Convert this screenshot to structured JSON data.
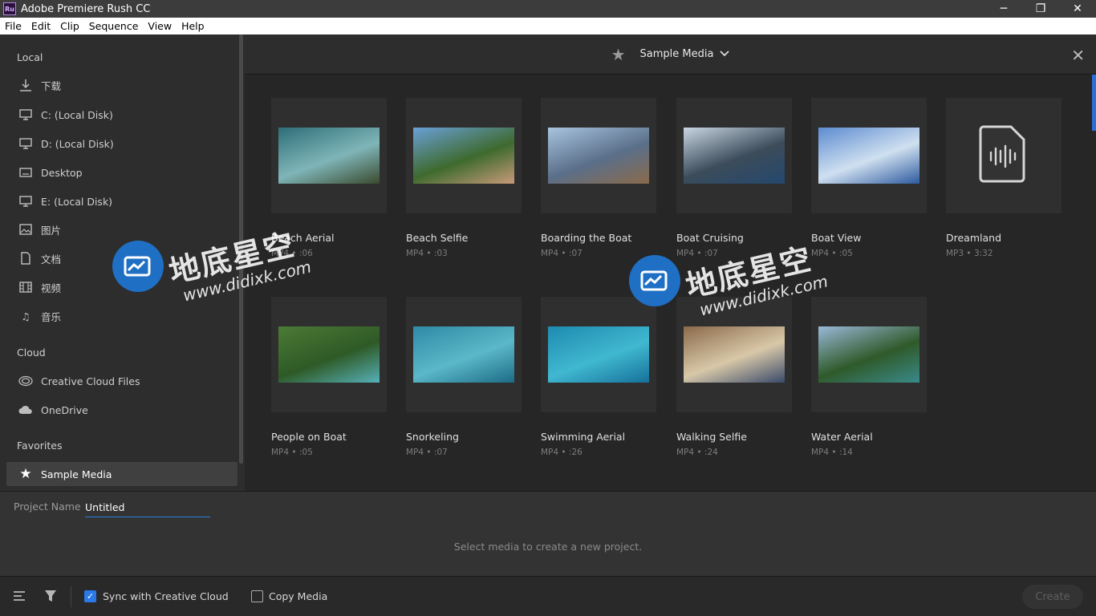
{
  "window": {
    "title": "Adobe Premiere Rush CC",
    "icon_text": "Ru",
    "controls": [
      "─",
      "❐",
      "✕"
    ]
  },
  "menu": [
    "File",
    "Edit",
    "Clip",
    "Sequence",
    "View",
    "Help"
  ],
  "sidebar": {
    "local_heading": "Local",
    "local_items": [
      {
        "label": "下载",
        "icon": "download-icon"
      },
      {
        "label": "C: (Local Disk)",
        "icon": "monitor-icon"
      },
      {
        "label": "D: (Local Disk)",
        "icon": "monitor-icon"
      },
      {
        "label": "Desktop",
        "icon": "desktop-icon"
      },
      {
        "label": "E: (Local Disk)",
        "icon": "monitor-icon"
      },
      {
        "label": "图片",
        "icon": "image-icon"
      },
      {
        "label": "文档",
        "icon": "document-icon"
      },
      {
        "label": "视频",
        "icon": "film-icon"
      },
      {
        "label": "音乐",
        "icon": "music-note-icon"
      }
    ],
    "cloud_heading": "Cloud",
    "cloud_items": [
      {
        "label": "Creative Cloud Files",
        "icon": "creative-cloud-icon"
      },
      {
        "label": "OneDrive",
        "icon": "cloud-icon"
      }
    ],
    "favorites_heading": "Favorites",
    "favorites_items": [
      {
        "label": "Sample Media",
        "icon": "star-icon",
        "active": true
      }
    ]
  },
  "header": {
    "title": "Sample Media",
    "close": "✕"
  },
  "media": [
    {
      "name": "Beach Aerial",
      "meta": "MP4 • :06",
      "colors": [
        "#2e6e78",
        "#7fb5b8",
        "#3a4a2e"
      ]
    },
    {
      "name": "Beach Selfie",
      "meta": "MP4 • :03",
      "colors": [
        "#6aa0d8",
        "#3e6a2e",
        "#c99a7a"
      ]
    },
    {
      "name": "Boarding the Boat",
      "meta": "MP4 • :07",
      "colors": [
        "#a9c4de",
        "#5a6f8a",
        "#8a6a4a"
      ]
    },
    {
      "name": "Boat Cruising",
      "meta": "MP4 • :07",
      "colors": [
        "#c9d6e2",
        "#3c4c5a",
        "#24486e"
      ]
    },
    {
      "name": "Boat View",
      "meta": "MP4 • :05",
      "colors": [
        "#5d8bd0",
        "#cfe0f0",
        "#2e5a9e"
      ]
    },
    {
      "name": "Dreamland",
      "meta": "MP3 • 3:32",
      "colors": []
    },
    {
      "name": "People on Boat",
      "meta": "MP4 • :05",
      "colors": [
        "#4c7a36",
        "#2e5a26",
        "#56b0b8"
      ]
    },
    {
      "name": "Snorkeling",
      "meta": "MP4 • :07",
      "colors": [
        "#2e8aa6",
        "#5ab8c8",
        "#1d6a86"
      ]
    },
    {
      "name": "Swimming Aerial",
      "meta": "MP4 • :26",
      "colors": [
        "#1e8ab0",
        "#40b8d0",
        "#16709a"
      ]
    },
    {
      "name": "Walking Selfie",
      "meta": "MP4 • :24",
      "colors": [
        "#8a6a4a",
        "#d8c8a8",
        "#3a4a6a"
      ]
    },
    {
      "name": "Water Aerial",
      "meta": "MP4 • :14",
      "colors": [
        "#9ab8d8",
        "#2f5a2a",
        "#3a8a8a"
      ]
    }
  ],
  "project": {
    "label": "Project Name",
    "value": "Untitled",
    "hint": "Select media to create a new project."
  },
  "footer": {
    "sync_label": "Sync with Creative Cloud",
    "sync_checked": true,
    "copy_label": "Copy Media",
    "copy_checked": false,
    "create_label": "Create"
  },
  "watermark": {
    "cn": "地底星空",
    "url": "www.didixk.com"
  }
}
